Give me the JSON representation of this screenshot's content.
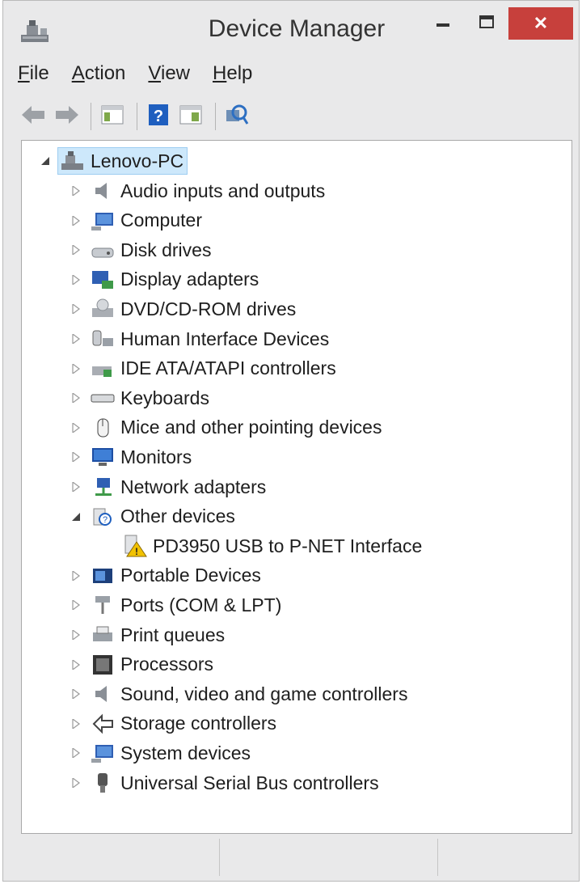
{
  "window": {
    "title": "Device Manager",
    "close_glyph": "✕"
  },
  "menu": [
    {
      "label": "File"
    },
    {
      "label": "Action"
    },
    {
      "label": "View"
    },
    {
      "label": "Help"
    }
  ],
  "toolbar": [
    "back-icon",
    "forward-icon",
    "properties-icon",
    "help-icon",
    "console-tree-icon",
    "scan-hardware-icon"
  ],
  "tree": {
    "root": {
      "label": "Lenovo-PC",
      "expanded": true,
      "selected": true,
      "icon": "computer-icon"
    },
    "items": [
      {
        "label": "Audio inputs and outputs",
        "icon": "speaker-icon"
      },
      {
        "label": "Computer",
        "icon": "computer-icon"
      },
      {
        "label": "Disk drives",
        "icon": "disk-drive-icon"
      },
      {
        "label": "Display adapters",
        "icon": "display-adapter-icon"
      },
      {
        "label": "DVD/CD-ROM drives",
        "icon": "dvd-drive-icon"
      },
      {
        "label": "Human Interface Devices",
        "icon": "hid-icon"
      },
      {
        "label": "IDE ATA/ATAPI controllers",
        "icon": "ide-controller-icon"
      },
      {
        "label": "Keyboards",
        "icon": "keyboard-icon"
      },
      {
        "label": "Mice and other pointing devices",
        "icon": "mouse-icon"
      },
      {
        "label": "Monitors",
        "icon": "monitor-icon"
      },
      {
        "label": "Network adapters",
        "icon": "network-adapter-icon"
      },
      {
        "label": "Other devices",
        "icon": "unknown-device-icon",
        "expanded": true,
        "children": [
          {
            "label": "PD3950 USB to P-NET Interface",
            "icon": "warning-device-icon"
          }
        ]
      },
      {
        "label": "Portable Devices",
        "icon": "portable-device-icon"
      },
      {
        "label": "Ports (COM & LPT)",
        "icon": "port-icon"
      },
      {
        "label": "Print queues",
        "icon": "printer-icon"
      },
      {
        "label": "Processors",
        "icon": "processor-icon"
      },
      {
        "label": "Sound, video and game controllers",
        "icon": "speaker-icon"
      },
      {
        "label": "Storage controllers",
        "icon": "storage-controller-icon"
      },
      {
        "label": "System devices",
        "icon": "system-device-icon"
      },
      {
        "label": "Universal Serial Bus controllers",
        "icon": "usb-icon"
      }
    ]
  },
  "colors": {
    "close_button": "#c7403c",
    "selection": "#cde8fb",
    "accent": "#1f5fbf"
  }
}
